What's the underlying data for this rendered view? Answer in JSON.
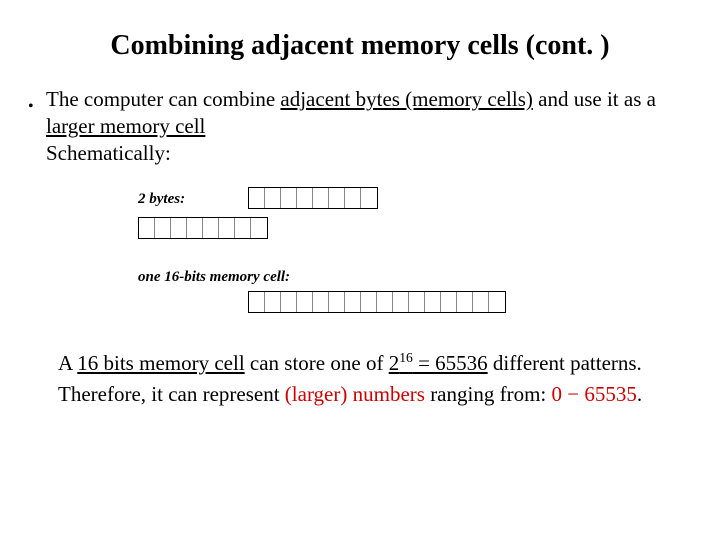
{
  "title": "Combining adjacent memory cells (cont. )",
  "bullet": {
    "line1_a": "The computer can combine ",
    "line1_b": "adjacent bytes (memory cells)",
    "line1_c": " and use it as a ",
    "line1_d": "larger memory cell",
    "line2": "Schematically:"
  },
  "schematic": {
    "label_two_bytes": "2 bytes:",
    "label_one_cell": "one 16-bits memory cell:"
  },
  "para1": {
    "a": "A ",
    "b": "16 bits memory cell",
    "c": " can store one of ",
    "d_base": "2",
    "d_sup": "16",
    "e": " = 65536",
    "f": " different patterns."
  },
  "para2": {
    "a": "Therefore, it can represent ",
    "b": "(larger) numbers",
    "c": " ranging from: ",
    "d": "0 − 65535",
    "e": "."
  }
}
